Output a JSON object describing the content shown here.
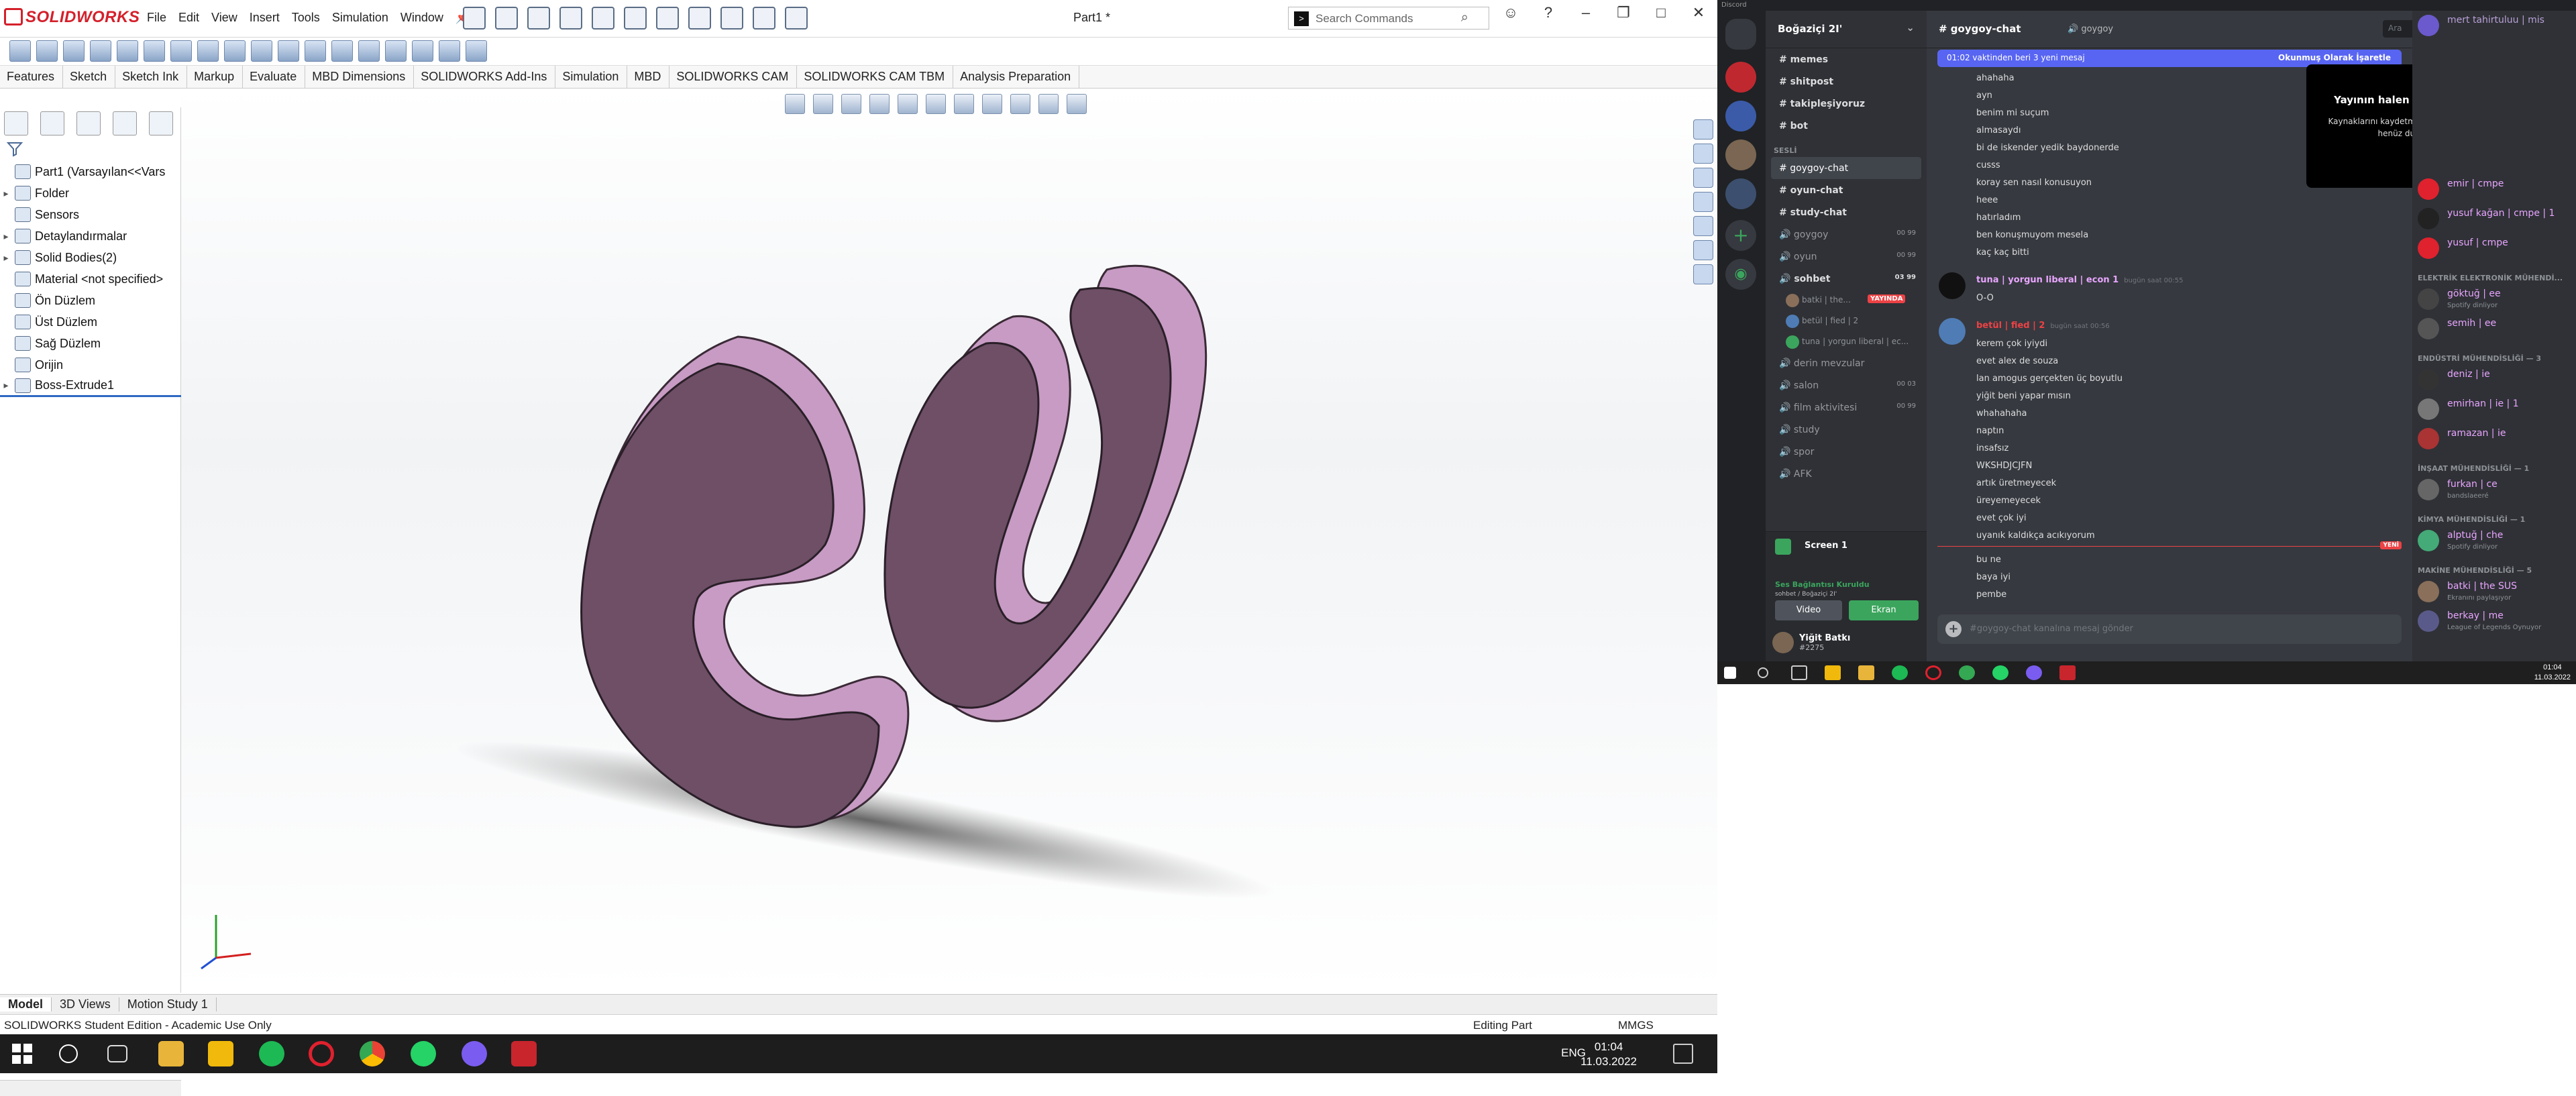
{
  "solidworks": {
    "logo_text": "SOLIDWORKS",
    "menu": [
      "File",
      "Edit",
      "View",
      "Insert",
      "Tools",
      "Simulation",
      "Window"
    ],
    "document_title": "Part1 *",
    "search_placeholder": "Search Commands",
    "tabs": [
      "Features",
      "Sketch",
      "Sketch Ink",
      "Markup",
      "Evaluate",
      "MBD Dimensions",
      "SOLIDWORKS Add-Ins",
      "Simulation",
      "MBD",
      "SOLIDWORKS CAM",
      "SOLIDWORKS CAM TBM",
      "Analysis Preparation"
    ],
    "tree": [
      {
        "label": "Part1  (Varsayılan<<Vars",
        "expand": ""
      },
      {
        "label": "Folder",
        "expand": "▸"
      },
      {
        "label": "Sensors",
        "expand": ""
      },
      {
        "label": "Detaylandırmalar",
        "expand": "▸"
      },
      {
        "label": "Solid Bodies(2)",
        "expand": "▸"
      },
      {
        "label": "Material <not specified>",
        "expand": ""
      },
      {
        "label": "Ön Düzlem",
        "expand": ""
      },
      {
        "label": "Üst Düzlem",
        "expand": ""
      },
      {
        "label": "Sağ Düzlem",
        "expand": ""
      },
      {
        "label": "Orijin",
        "expand": ""
      },
      {
        "label": "Boss-Extrude1",
        "expand": "▸"
      }
    ],
    "bottom_tabs": [
      "Model",
      "3D Views",
      "Motion Study 1"
    ],
    "status_left": "SOLIDWORKS Student Edition - Academic Use Only",
    "status_mode": "Editing Part",
    "status_units": "MMGS",
    "model_color": "#6e4f66",
    "model_edge_color": "#c79bc4",
    "taskbar": {
      "lang": "ENG",
      "time": "01:04",
      "date": "11.03.2022"
    }
  },
  "discord": {
    "window_label": "Discord",
    "server_name": "Boğaziçi 2I'",
    "channels_top": [
      "memes",
      "shitpost",
      "takipleşiyoruz",
      "bot"
    ],
    "category_sesli": "SESLİ",
    "text_channels": [
      "goygoy-chat",
      "oyun-chat",
      "study-chat"
    ],
    "voice_channels": [
      {
        "name": "goygoy",
        "count": "00 99"
      },
      {
        "name": "oyun",
        "count": "00 99"
      },
      {
        "name": "sohbet",
        "count": "03 99"
      }
    ],
    "voice_users": [
      {
        "name": "batki | the...",
        "live": "YAYINDA"
      },
      {
        "name": "betül | fied | 2",
        "live": ""
      },
      {
        "name": "tuna | yorgun liberal | ec...",
        "live": ""
      }
    ],
    "more_channels": [
      {
        "name": "derin mevzular",
        "count": ""
      },
      {
        "name": "salon",
        "count": "00 03"
      },
      {
        "name": "film aktivitesi",
        "count": "00 99"
      },
      {
        "name": "study",
        "count": ""
      },
      {
        "name": "spor",
        "count": ""
      },
      {
        "name": "AFK",
        "count": ""
      }
    ],
    "screen_share": {
      "title": "Screen 1",
      "connection": "Ses Bağlantısı Kuruldu",
      "location": "sohbet / Boğaziçi 2I'",
      "video_btn": "Video",
      "screen_btn": "Ekran"
    },
    "user": {
      "name": "Yiğit Batkı",
      "tag": "#2275"
    },
    "channel_header": "goygoy-chat",
    "header_voice": "goygoy",
    "search_placeholder": "Ara",
    "new_messages": "01:02 vaktinden beri 3 yeni mesaj",
    "mark_read": "Okunmuş Olarak İşaretle",
    "messages_a": [
      "ahahaha",
      "ayn",
      "benim mi suçum",
      "almasaydı",
      "bi de iskender yedik baydonerde",
      "cusss",
      "koray sen nasıl konusuyon",
      "heee",
      "hatırladım",
      "ben konuşmuyom mesela",
      "kaç kaç bitti"
    ],
    "author_tuna": "tuna | yorgun liberal | econ 1",
    "author_tuna_time": "bugün saat 00:55",
    "messages_b": [
      "O-O"
    ],
    "author_betul": "betül | fied | 2",
    "author_betul_time": "bugün saat 00:56",
    "messages_c": [
      "kerem çok iyiydi",
      "evet alex de souza",
      "lan amogus gerçekten üç boyutlu",
      "yiğit beni yapar mısın",
      "whahahaha",
      "naptın",
      "insafsız",
      "WKSHDJCJFN",
      "artık üretmeyecek",
      "üreyemeyecek",
      "evet çok iyi",
      "uyanık kaldıkça acıkıyorum"
    ],
    "new_label": "YENİ",
    "messages_d": [
      "bu ne",
      "baya iyi",
      "pembe"
    ],
    "input_placeholder": "#goygoy-chat kanalına mesaj gönder",
    "stream_tooltip_title": "Yayının halen devam ediyor!",
    "stream_tooltip_body": "Kaynaklarını kaydetmek için bu önizlemeyi henüz duraklattık.",
    "members": [
      {
        "type": "user",
        "name": "mert tahirtuluu | mis",
        "sub": "",
        "color": "#b9a0d6"
      },
      {
        "type": "user",
        "name": "emir | cmpe",
        "sub": "",
        "color": "#e8a5ff"
      },
      {
        "type": "user",
        "name": "yusuf kağan | cmpe | 1",
        "sub": "",
        "color": "#e8a5ff"
      },
      {
        "type": "user",
        "name": "yusuf | cmpe",
        "sub": "",
        "color": "#e8a5ff"
      },
      {
        "type": "group",
        "name": "ELEKTRİK ELEKTRONİK MÜHENDİ..."
      },
      {
        "type": "user",
        "name": "göktuğ | ee",
        "sub": "Spotify dinliyor",
        "color": "#e8a5ff"
      },
      {
        "type": "user",
        "name": "semih | ee",
        "sub": "",
        "color": "#e8a5ff"
      },
      {
        "type": "group",
        "name": "ENDÜSTRİ MÜHENDİSLİĞİ — 3"
      },
      {
        "type": "user",
        "name": "deniz | ie",
        "sub": "",
        "color": "#e8a5ff"
      },
      {
        "type": "user",
        "name": "emirhan | ie | 1",
        "sub": "",
        "color": "#e8a5ff"
      },
      {
        "type": "user",
        "name": "ramazan | ie",
        "sub": "",
        "color": "#e8a5ff"
      },
      {
        "type": "group",
        "name": "İNŞAAT MÜHENDİSLİĞİ — 1"
      },
      {
        "type": "user",
        "name": "furkan | ce",
        "sub": "bandslaeeré",
        "color": "#e8a5ff"
      },
      {
        "type": "group",
        "name": "KİMYA MÜHENDİSLİĞİ — 1"
      },
      {
        "type": "user",
        "name": "alptuğ | che",
        "sub": "Spotify dinliyor",
        "color": "#e8a5ff"
      },
      {
        "type": "group",
        "name": "MAKİNE MÜHENDİSLİĞİ — 5"
      },
      {
        "type": "user",
        "name": "batki | the SUS",
        "sub": "Ekranını paylaşıyor",
        "color": "#e8a5ff"
      },
      {
        "type": "user",
        "name": "berkay | me",
        "sub": "League of Legends Oynuyor",
        "color": "#e8a5ff"
      }
    ],
    "taskbar": {
      "time": "01:04",
      "date": "11.03.2022"
    }
  }
}
